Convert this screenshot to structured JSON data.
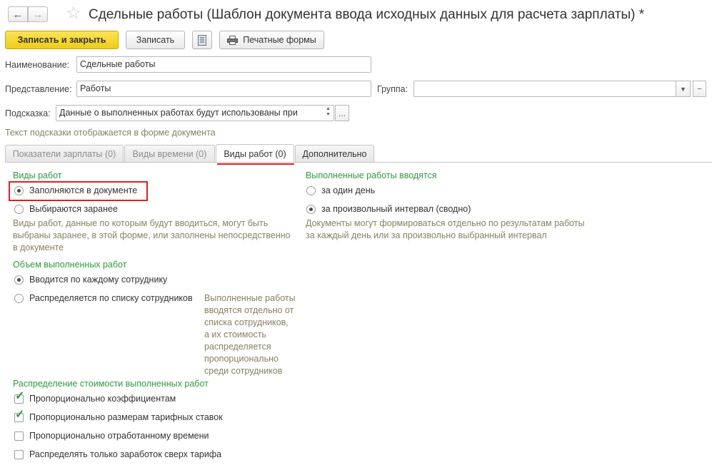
{
  "window": {
    "title": "Сдельные работы (Шаблон документа ввода исходных данных для расчета зарплаты) *"
  },
  "toolbar": {
    "save_close_label": "Записать и закрыть",
    "save_label": "Записать",
    "print_forms_label": "Печатные формы"
  },
  "fields": {
    "name_label": "Наименование:",
    "name_value": "Сдельные работы",
    "representation_label": "Представление:",
    "representation_value": "Работы",
    "group_label": "Группа:",
    "group_value": "",
    "hint_label": "Подсказка:",
    "hint_value": "Данные о выполненных работах будут использованы при",
    "hint_note": "Текст подсказки отображается в форме документа"
  },
  "tabs": [
    {
      "label": "Показатели зарплаты (0)"
    },
    {
      "label": "Виды времени (0)"
    },
    {
      "label": "Виды работ (0)"
    },
    {
      "label": "Дополнительно"
    }
  ],
  "work_types": {
    "title": "Виды работ",
    "option_in_document": "Заполняются в документе",
    "option_preselected": "Выбираются заранее",
    "description_lines": [
      "Виды работ, данные по которым будут вводиться, могут быть",
      "выбраны заранее, в этой форме, или заполнены непосредственно",
      "в документе"
    ]
  },
  "entry_mode": {
    "title": "Выполненные работы вводятся",
    "option_one_day": "за один день",
    "option_interval": "за произвольный интервал (сводно)",
    "description_lines": [
      "Документы могут формироваться отдельно по результатам работы",
      "за каждый день или за произвольно выбранный интервал"
    ]
  },
  "volume": {
    "title": "Объем выполненных работ",
    "option_each_employee": "Вводится по каждому сотруднику",
    "option_distribute": "Распределяется по списку сотрудников",
    "description_lines": [
      "Выполненные работы",
      "вводятся отдельно от",
      "списка сотрудников,",
      "а их стоимость",
      "распределяется",
      "пропорционально",
      "среди сотрудников"
    ]
  },
  "distribution": {
    "title": "Распределение стоимости выполненных работ",
    "items": [
      {
        "label": "Пропорционально коэффициентам",
        "checked": true
      },
      {
        "label": "Пропорционально размерам тарифных ставок",
        "checked": true
      },
      {
        "label": "Пропорционально отработанному времени",
        "checked": false
      },
      {
        "label": "Распределять только заработок сверх тарифа",
        "checked": false
      }
    ]
  },
  "colors": {
    "accent_yellow": "#f5d52a",
    "group_title_green": "#2e9a3f",
    "description_brown": "#8a7f63",
    "highlight_red": "#e0201f"
  }
}
